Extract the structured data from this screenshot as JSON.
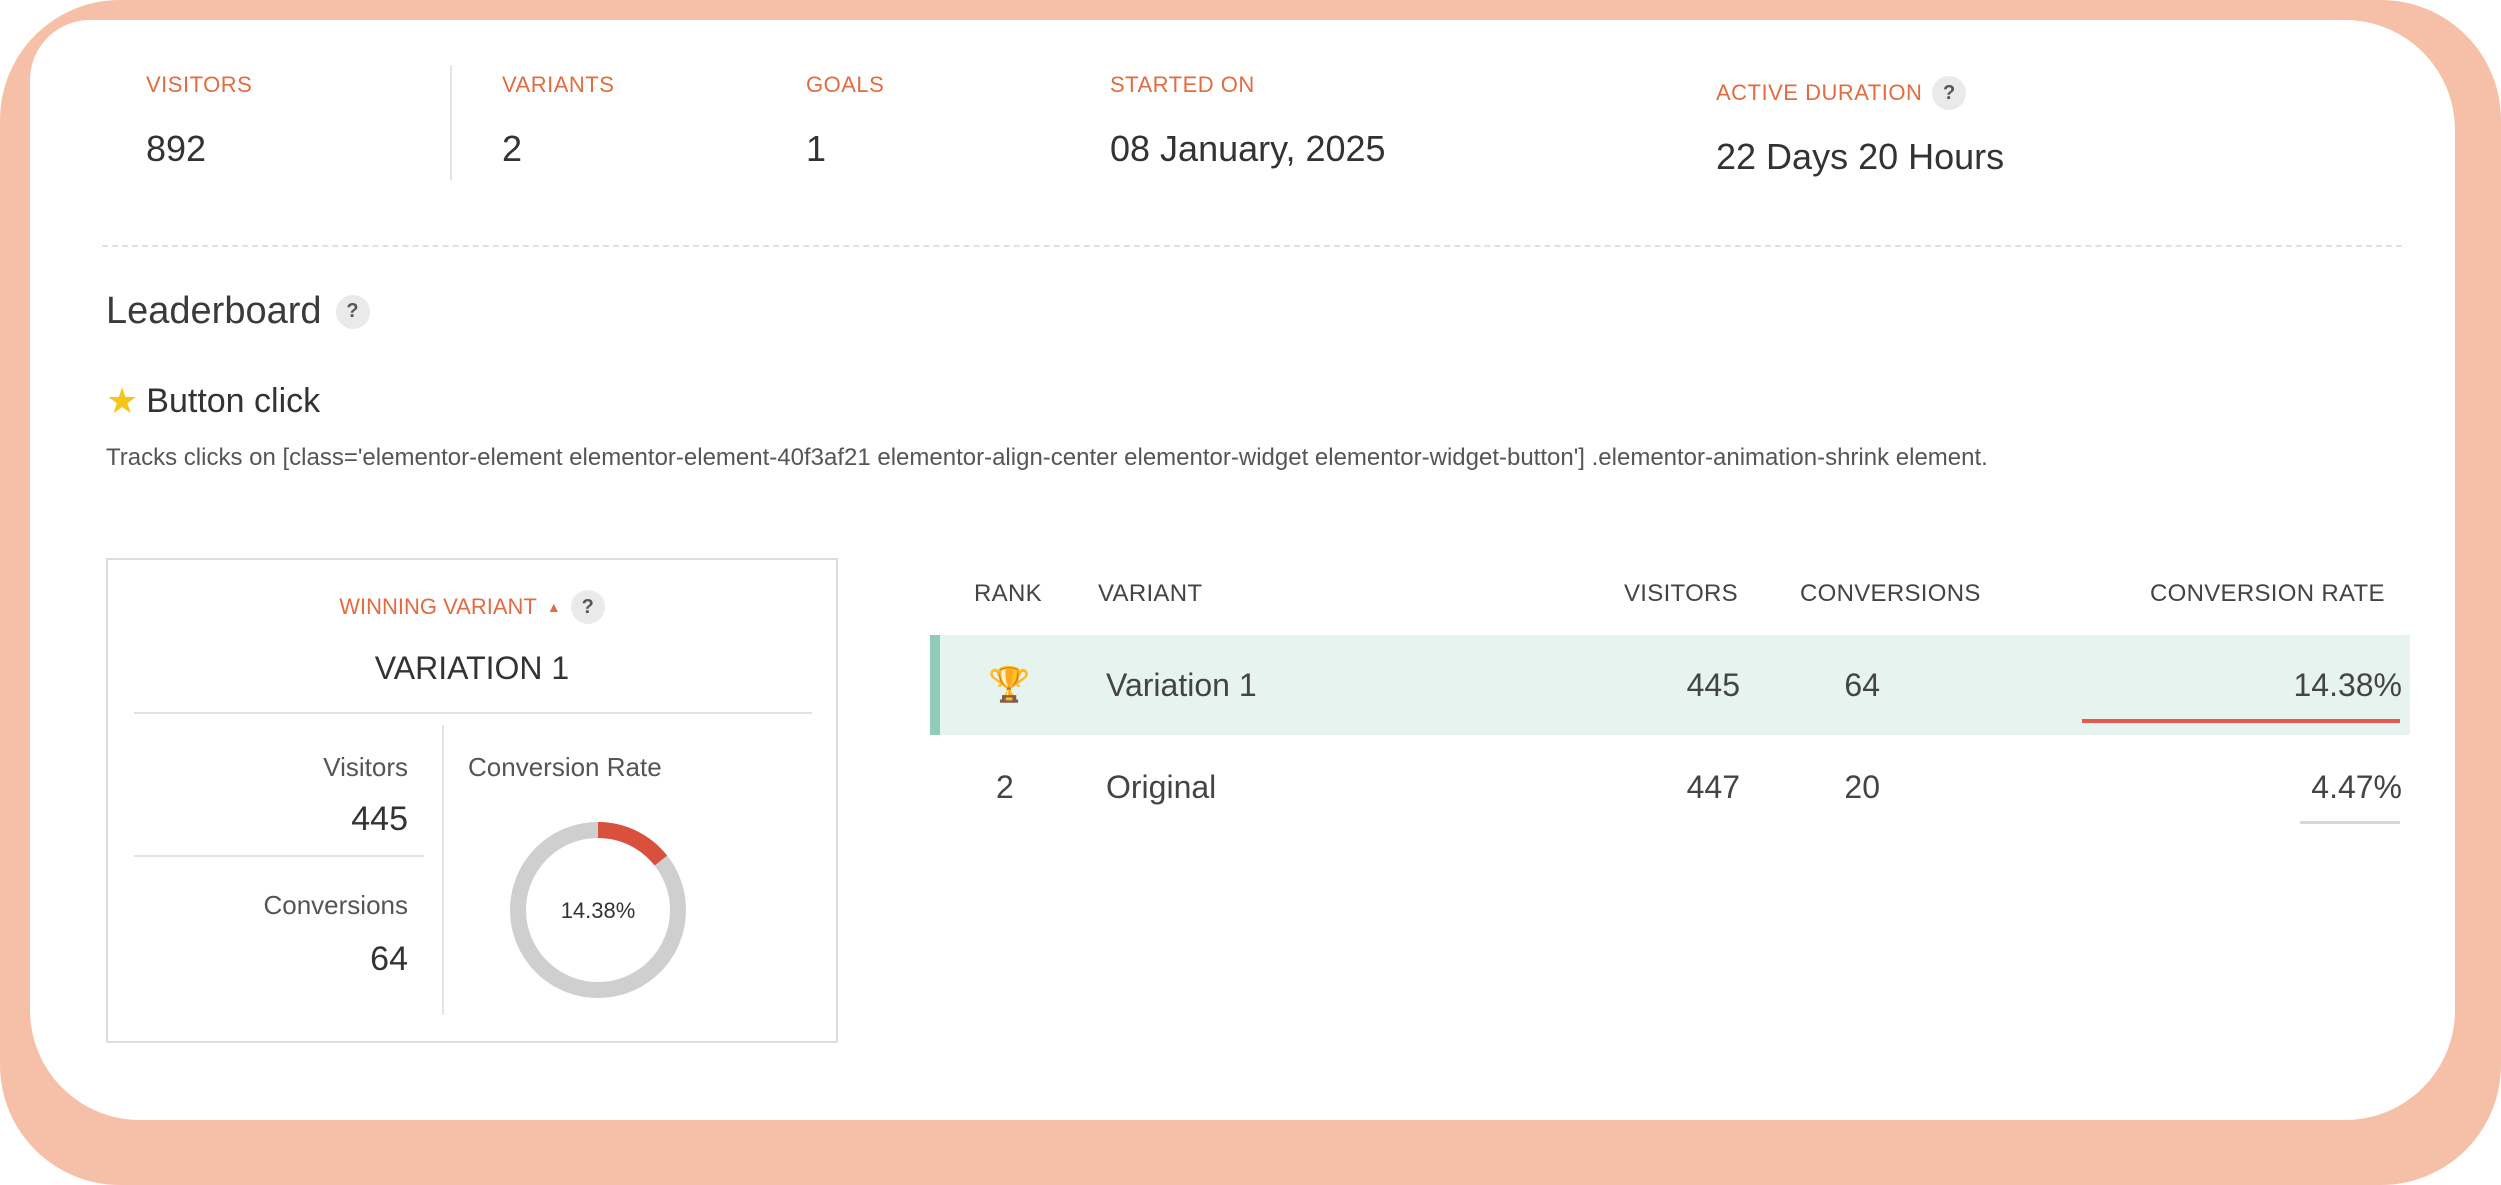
{
  "stats": {
    "visitors": {
      "label": "VISITORS",
      "value": "892"
    },
    "variants": {
      "label": "VARIANTS",
      "value": "2"
    },
    "goals": {
      "label": "GOALS",
      "value": "1"
    },
    "started_on": {
      "label": "STARTED ON",
      "value": "08 January, 2025"
    },
    "active_duration": {
      "label": "ACTIVE DURATION",
      "value": "22 Days 20 Hours",
      "help": "?"
    }
  },
  "leaderboard": {
    "title": "Leaderboard",
    "help": "?",
    "goal": {
      "icon": "star-icon",
      "title": "Button click",
      "description": "Tracks clicks on [class='elementor-element elementor-element-40f3af21 elementor-align-center elementor-widget elementor-widget-button'] .elementor-animation-shrink element."
    }
  },
  "winning": {
    "label": "WINNING VARIANT",
    "help": "?",
    "name": "VARIATION 1",
    "visitors_label": "Visitors",
    "visitors": "445",
    "conversions_label": "Conversions",
    "conversions": "64",
    "rate_label": "Conversion Rate",
    "rate_text": "14.38%",
    "rate_value": 0.1438
  },
  "table": {
    "headers": {
      "rank": "RANK",
      "variant": "VARIANT",
      "visitors": "VISITORS",
      "conversions": "CONVERSIONS",
      "rate": "CONVERSION RATE"
    },
    "rows": [
      {
        "rank": "trophy",
        "variant": "Variation 1",
        "visitors": "445",
        "conversions": "64",
        "rate": "14.38%"
      },
      {
        "rank": "2",
        "variant": "Original",
        "visitors": "447",
        "conversions": "20",
        "rate": "4.47%"
      }
    ]
  },
  "colors": {
    "accent": "#e36b3f",
    "frame": "#f6c0a8",
    "winner_row": "#e6f3ee",
    "winner_bar": "#8fcdb6",
    "donut_fill": "#d9503d",
    "donut_track": "#cfcfcf"
  }
}
